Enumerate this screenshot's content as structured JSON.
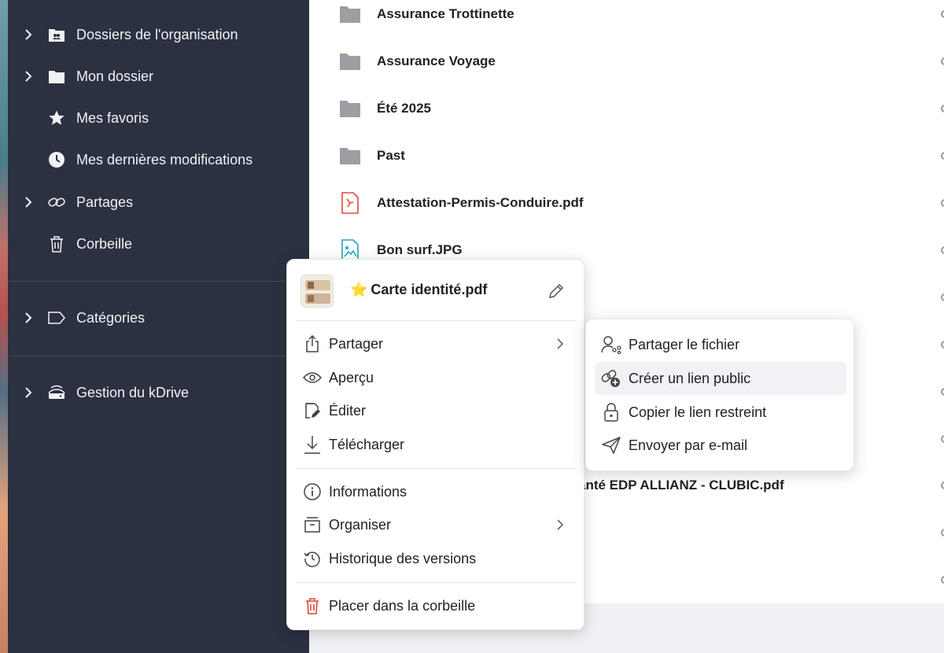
{
  "sidebar": {
    "items": [
      {
        "label": "Dossiers de l'organisation",
        "icon": "team-folder-icon",
        "expandable": true
      },
      {
        "label": "Mon dossier",
        "icon": "folder-icon",
        "expandable": true
      },
      {
        "label": "Mes favoris",
        "icon": "star-icon",
        "expandable": false
      },
      {
        "label": "Mes dernières modifications",
        "icon": "clock-icon",
        "expandable": false
      },
      {
        "label": "Partages",
        "icon": "link-icon",
        "expandable": true
      },
      {
        "label": "Corbeille",
        "icon": "trash-icon",
        "expandable": false
      },
      {
        "label": "Catégories",
        "icon": "tag-icon",
        "expandable": true
      },
      {
        "label": "Gestion du kDrive",
        "icon": "drive-icon",
        "expandable": true
      }
    ]
  },
  "files": [
    {
      "name": "Assurance Trottinette",
      "type": "folder"
    },
    {
      "name": "Assurance Voyage",
      "type": "folder"
    },
    {
      "name": "Été 2025",
      "type": "folder"
    },
    {
      "name": "Past",
      "type": "folder"
    },
    {
      "name": "Attestation-Permis-Conduire.pdf",
      "type": "pdf"
    },
    {
      "name": "Bon surf.JPG",
      "type": "image"
    },
    {
      "name": "anté EDP ALLIANZ - CLUBIC.pdf",
      "type": "pdf"
    }
  ],
  "context_menu": {
    "title": "Carte identité.pdf",
    "favorite_glyph": "⭐",
    "items": [
      {
        "label": "Partager",
        "icon": "share-icon",
        "submenu": true
      },
      {
        "label": "Aperçu",
        "icon": "eye-icon",
        "submenu": false
      },
      {
        "label": "Éditer",
        "icon": "edit-doc-icon",
        "submenu": false
      },
      {
        "label": "Télécharger",
        "icon": "download-icon",
        "submenu": false
      },
      {
        "label": "Informations",
        "icon": "info-icon",
        "submenu": false
      },
      {
        "label": "Organiser",
        "icon": "organize-icon",
        "submenu": true
      },
      {
        "label": "Historique des versions",
        "icon": "history-icon",
        "submenu": false
      },
      {
        "label": "Placer dans la corbeille",
        "icon": "trash-icon",
        "submenu": false
      }
    ]
  },
  "share_submenu": {
    "items": [
      {
        "label": "Partager le fichier",
        "icon": "share-user-icon"
      },
      {
        "label": "Créer un lien public",
        "icon": "add-link-icon"
      },
      {
        "label": "Copier le lien restreint",
        "icon": "lock-icon"
      },
      {
        "label": "Envoyer par e-mail",
        "icon": "send-icon"
      }
    ]
  },
  "colors": {
    "sidebar_bg": "#2b3141",
    "folder": "#9b9ea3",
    "pdf_red": "#e0483c",
    "image_blue": "#1fa6c9",
    "trash_red": "#e0483c"
  }
}
